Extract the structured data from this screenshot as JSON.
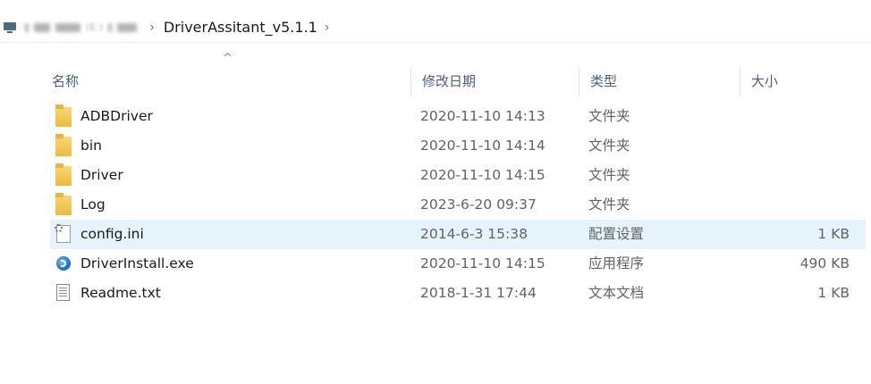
{
  "breadcrumb": {
    "drive_label": "(E:)",
    "current_folder": "DriverAssitant_v5.1.1",
    "separator": "›"
  },
  "sort_indicator": "^",
  "columns": {
    "name": "名称",
    "date": "修改日期",
    "type": "类型",
    "size": "大小"
  },
  "files": [
    {
      "name": "ADBDriver",
      "date": "2020-11-10 14:13",
      "type": "文件夹",
      "size": "",
      "icon": "folder-icon"
    },
    {
      "name": "bin",
      "date": "2020-11-10 14:14",
      "type": "文件夹",
      "size": "",
      "icon": "folder-icon"
    },
    {
      "name": "Driver",
      "date": "2020-11-10 14:15",
      "type": "文件夹",
      "size": "",
      "icon": "folder-icon"
    },
    {
      "name": "Log",
      "date": "2023-6-20 09:37",
      "type": "文件夹",
      "size": "",
      "icon": "folder-icon"
    },
    {
      "name": "config.ini",
      "date": "2014-6-3 15:38",
      "type": "配置设置",
      "size": "1 KB",
      "icon": "config-file-icon"
    },
    {
      "name": "DriverInstall.exe",
      "date": "2020-11-10 14:15",
      "type": "应用程序",
      "size": "490 KB",
      "icon": "exe-file-icon"
    },
    {
      "name": "Readme.txt",
      "date": "2018-1-31 17:44",
      "type": "文本文档",
      "size": "1 KB",
      "icon": "text-file-icon"
    }
  ],
  "selected_row": 4,
  "colors": {
    "row_highlight": "#e5f3fb",
    "header_text": "#4c607a",
    "folder": "#eeba3c"
  }
}
